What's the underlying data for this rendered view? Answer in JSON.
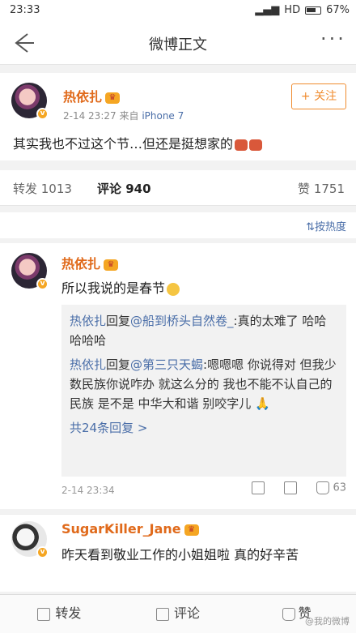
{
  "status": {
    "time": "23:33",
    "signal": "HD",
    "battery": "67%"
  },
  "nav": {
    "title": "微博正文"
  },
  "post": {
    "username": "热依扎",
    "time": "2-14 23:27",
    "source_prefix": "来自",
    "source": "iPhone 7",
    "follow_label": "+ 关注",
    "content": "其实我也不过这个节…但还是挺想家的"
  },
  "tabs": {
    "repost": "转发 1013",
    "comment": "评论 940",
    "like": "赞 1751"
  },
  "sort": "按热度",
  "comment1": {
    "username": "热依扎",
    "text": "所以我说的是春节",
    "replies": [
      {
        "name": "热依扎",
        "action": "回复",
        "target": "@船到桥头自然卷_",
        "text": ":真的太难了 哈哈哈哈哈"
      },
      {
        "name": "热依扎",
        "action": "回复",
        "target": "@第三只天蝎",
        "text": ":嗯嗯嗯 你说得对 但我少数民族你说咋办 就这么分的 我也不能不认自己的民族 是不是 中华大和谐 别咬字儿"
      }
    ],
    "more_replies": "共24条回复 >",
    "time": "2-14 23:34",
    "likes": "63"
  },
  "comment2": {
    "username": "SugarKiller_Jane",
    "text": "昨天看到敬业工作的小姐姐啦 真的好辛苦"
  },
  "bottom": {
    "repost": "转发",
    "comment": "评论",
    "like": "赞"
  },
  "watermark": "@我的微博"
}
